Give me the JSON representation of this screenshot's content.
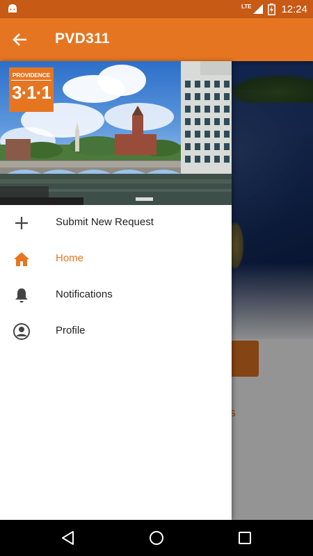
{
  "status_bar": {
    "network": "LTE",
    "time": "12:24",
    "icons": [
      "android-icon",
      "lte-signal-icon",
      "battery-icon"
    ]
  },
  "app_bar": {
    "title": "PVD311",
    "back_icon": "arrow-left-icon"
  },
  "drawer": {
    "logo": {
      "top_text": "PROVIDENCE",
      "number": "3·1·1"
    },
    "items": [
      {
        "label": "Submit New Request",
        "icon": "plus-icon",
        "active": false
      },
      {
        "label": "Home",
        "icon": "home-icon",
        "active": true
      },
      {
        "label": "Notifications",
        "icon": "bell-icon",
        "active": false
      },
      {
        "label": "Profile",
        "icon": "person-circle-icon",
        "active": false
      }
    ]
  },
  "background": {
    "services_text": "vices"
  },
  "colors": {
    "primary": "#e67522",
    "primary_dark": "#c75a14",
    "active_text": "#e67522",
    "text": "#222222"
  },
  "nav_bar": {
    "icons": [
      "back-triangle-icon",
      "home-circle-icon",
      "recents-square-icon"
    ]
  }
}
